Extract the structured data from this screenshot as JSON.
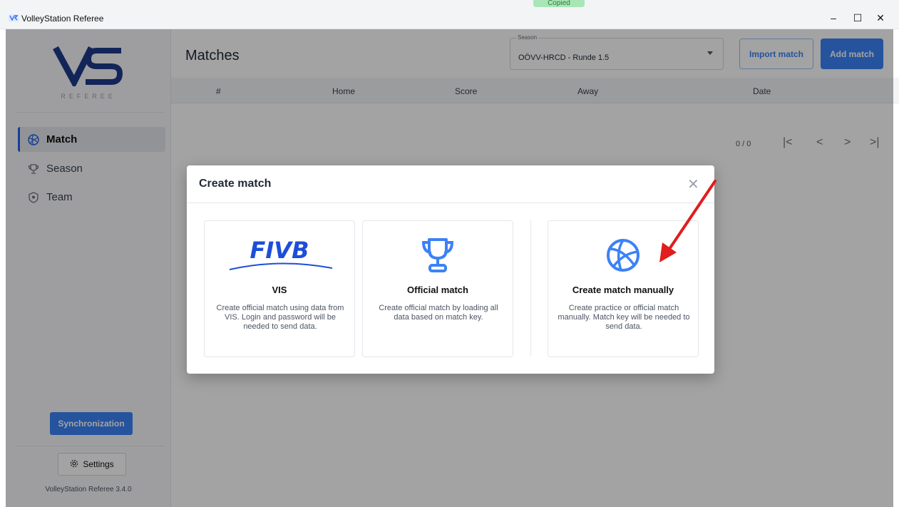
{
  "titlebar": {
    "title": "VolleyStation Referee",
    "copied_badge": "Copied",
    "minimize": "–",
    "maximize": "☐",
    "close": "✕"
  },
  "sidebar": {
    "logo_text": "VS",
    "logo_sub": "REFEREE",
    "items": [
      {
        "label": "Match",
        "icon": "volleyball-icon",
        "active": true
      },
      {
        "label": "Season",
        "icon": "trophy-icon",
        "active": false
      },
      {
        "label": "Team",
        "icon": "shield-icon",
        "active": false
      }
    ],
    "sync_label": "Synchronization",
    "settings_label": "Settings",
    "version": "VolleyStation Referee 3.4.0"
  },
  "main": {
    "title": "Matches",
    "season": {
      "label": "Season",
      "value": "OÖVV-HRCD - Runde 1.5"
    },
    "import_label": "Import match",
    "add_label": "Add match",
    "columns": [
      "#",
      "Home",
      "Score",
      "Away",
      "Date"
    ],
    "pager": {
      "text": "0 / 0",
      "first": "|<",
      "prev": "<",
      "next": ">",
      "last": ">|"
    }
  },
  "modal": {
    "title": "Create match",
    "close": "✕",
    "cards": [
      {
        "title": "VIS",
        "icon": "fivb-logo",
        "desc": "Create official match using data from VIS. Login and password will be needed to send data."
      },
      {
        "title": "Official match",
        "icon": "trophy-icon",
        "desc": "Create official match by loading all data based on match key."
      },
      {
        "title": "Create match manually",
        "icon": "volleyball-icon",
        "desc": "Create practice or official match manually. Match key will be needed to send data."
      }
    ],
    "fivb_text": "FIVB"
  },
  "colors": {
    "accent": "#3b82f6",
    "arrow": "#e11d1d"
  }
}
